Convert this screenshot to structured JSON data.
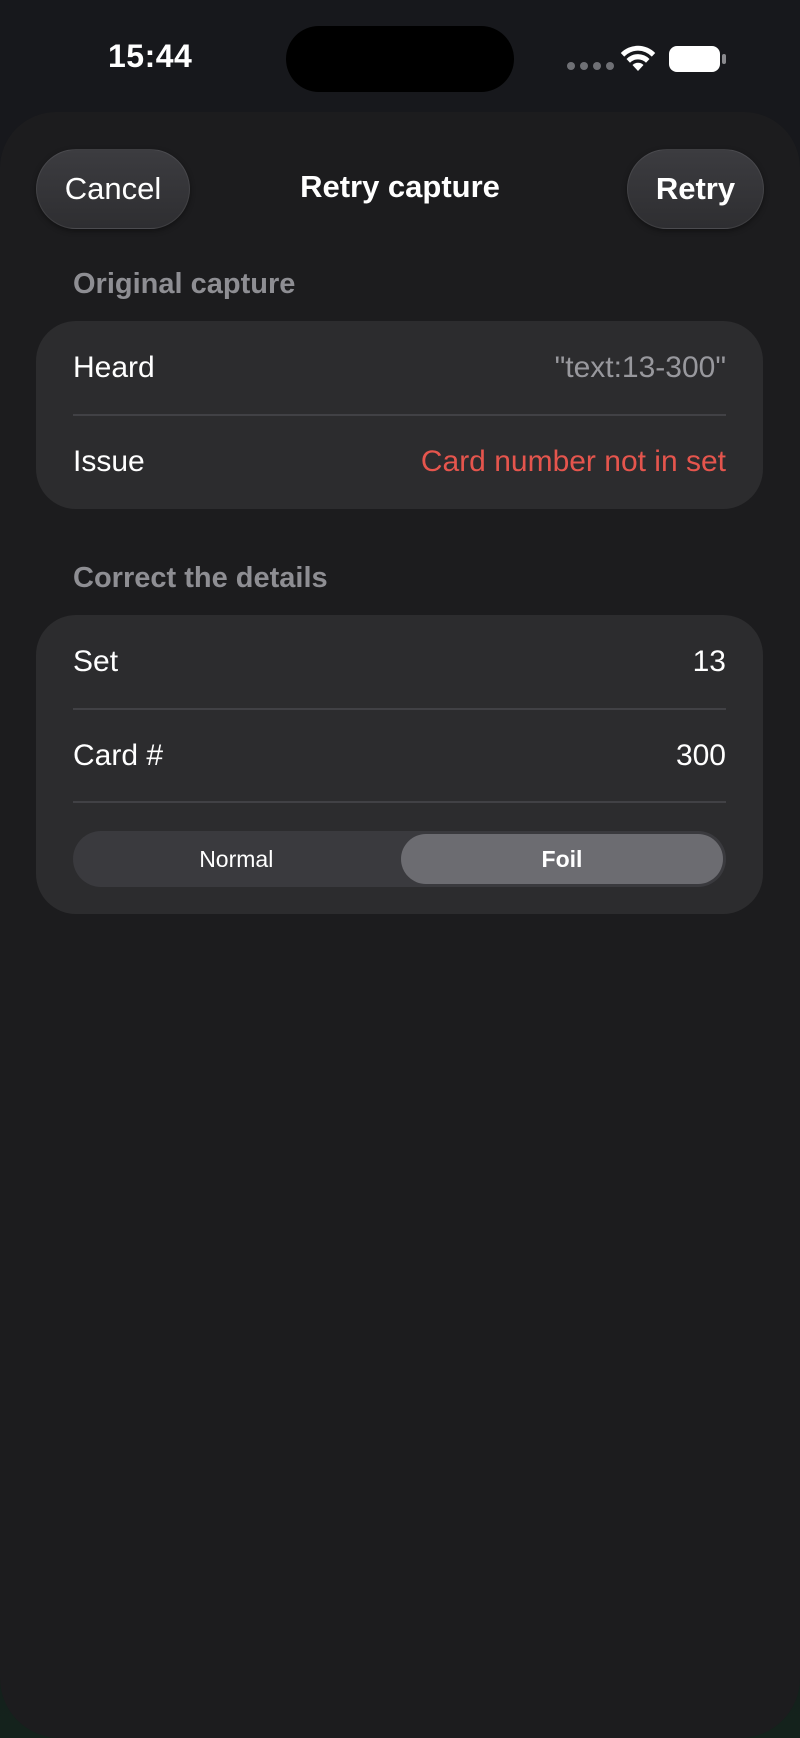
{
  "status_bar": {
    "time": "15:44"
  },
  "nav": {
    "cancel_label": "Cancel",
    "title": "Retry capture",
    "retry_label": "Retry"
  },
  "original_capture": {
    "header": "Original capture",
    "rows": [
      {
        "label": "Heard",
        "value": "\"text:13-300\""
      },
      {
        "label": "Issue",
        "value": "Card number not in set"
      }
    ]
  },
  "correct_details": {
    "header": "Correct the details",
    "rows": [
      {
        "label": "Set",
        "value": "13"
      },
      {
        "label": "Card #",
        "value": "300"
      }
    ],
    "finish_options": [
      "Normal",
      "Foil"
    ],
    "selected_finish": "Foil"
  },
  "colors": {
    "error": "#e5554d",
    "sheet_background": "#1c1c1e",
    "group_background": "#2c2c2e"
  },
  "icons": [
    "signal-dots-icon",
    "wifi-icon",
    "battery-icon"
  ]
}
